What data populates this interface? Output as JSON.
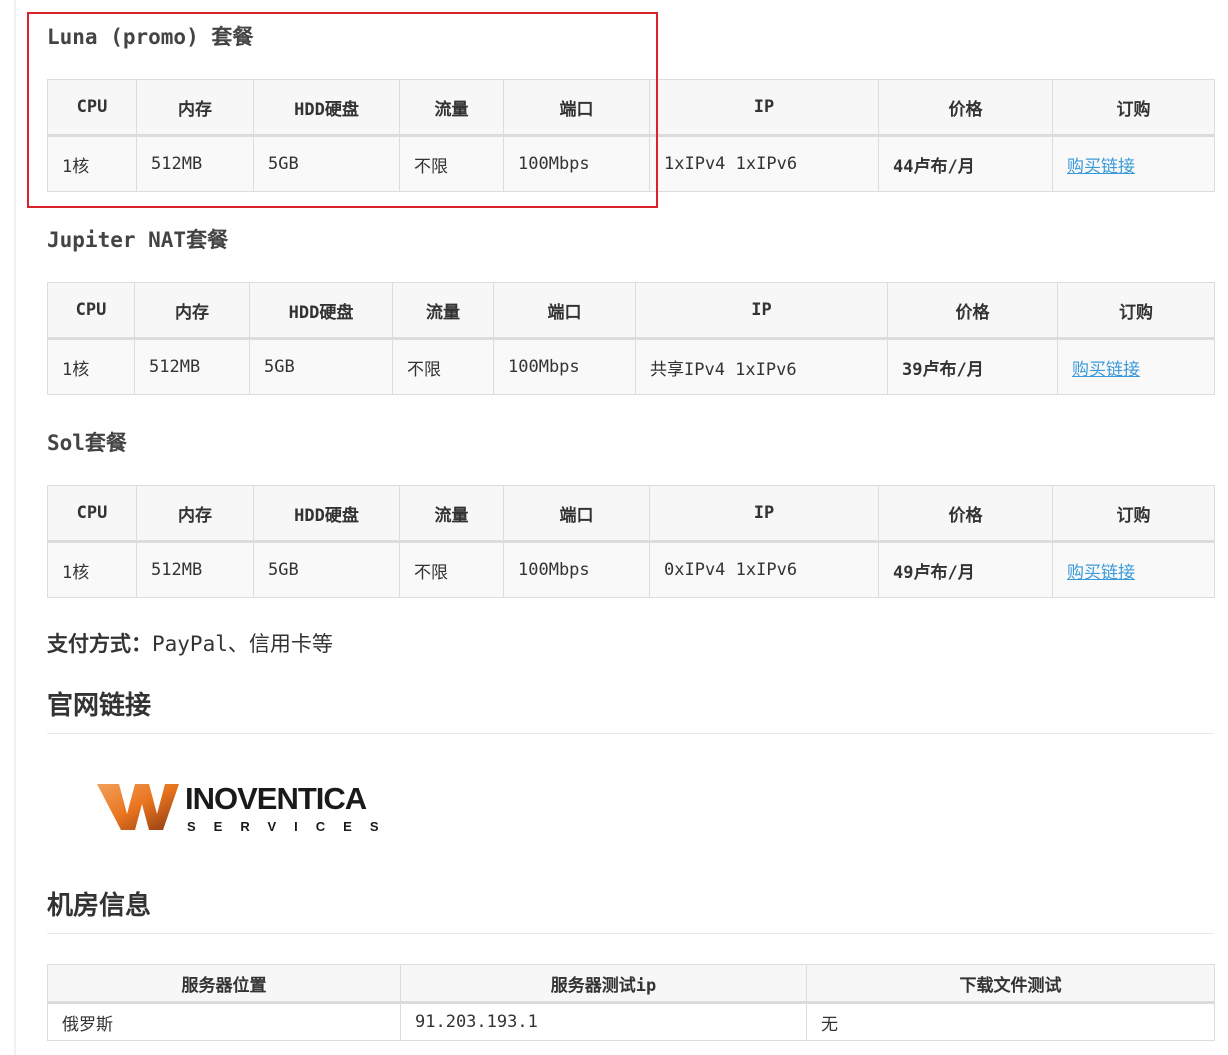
{
  "plans": [
    {
      "title": "Luna (promo) 套餐",
      "headers": [
        "CPU",
        "内存",
        "HDD硬盘",
        "流量",
        "端口",
        "IP",
        "价格",
        "订购"
      ],
      "row": {
        "cpu": "1核",
        "ram": "512MB",
        "disk": "5GB",
        "traffic": "不限",
        "port": "100Mbps",
        "ip": "1xIPv4 1xIPv6",
        "price": "44卢布/月",
        "buy": "购买链接"
      }
    },
    {
      "title": "Jupiter NAT套餐",
      "headers": [
        "CPU",
        "内存",
        "HDD硬盘",
        "流量",
        "端口",
        "IP",
        "价格",
        "订购"
      ],
      "row": {
        "cpu": "1核",
        "ram": "512MB",
        "disk": "5GB",
        "traffic": "不限",
        "port": "100Mbps",
        "ip": "共享IPv4 1xIPv6",
        "price": "39卢布/月",
        "buy": "购买链接"
      }
    },
    {
      "title": "Sol套餐",
      "headers": [
        "CPU",
        "内存",
        "HDD硬盘",
        "流量",
        "端口",
        "IP",
        "价格",
        "订购"
      ],
      "row": {
        "cpu": "1核",
        "ram": "512MB",
        "disk": "5GB",
        "traffic": "不限",
        "port": "100Mbps",
        "ip": "0xIPv4 1xIPv6",
        "price": "49卢布/月",
        "buy": "购买链接"
      }
    }
  ],
  "payment": {
    "label": "支付方式：",
    "value": "PayPal、信用卡等"
  },
  "official_title": "官网链接",
  "logo": {
    "name": "INOVENTICA",
    "sub": "SERVICES",
    "colors": {
      "orange": "#e8731f",
      "dark": "#1a1a1a"
    }
  },
  "datacenter_title": "机房信息",
  "datacenter": {
    "headers": [
      "服务器位置",
      "服务器测试ip",
      "下载文件测试"
    ],
    "rows": [
      [
        "俄罗斯",
        "91.203.193.1",
        "无"
      ]
    ]
  },
  "colors": {
    "link": "#3a9ad9",
    "highlight": "#d9242c"
  }
}
